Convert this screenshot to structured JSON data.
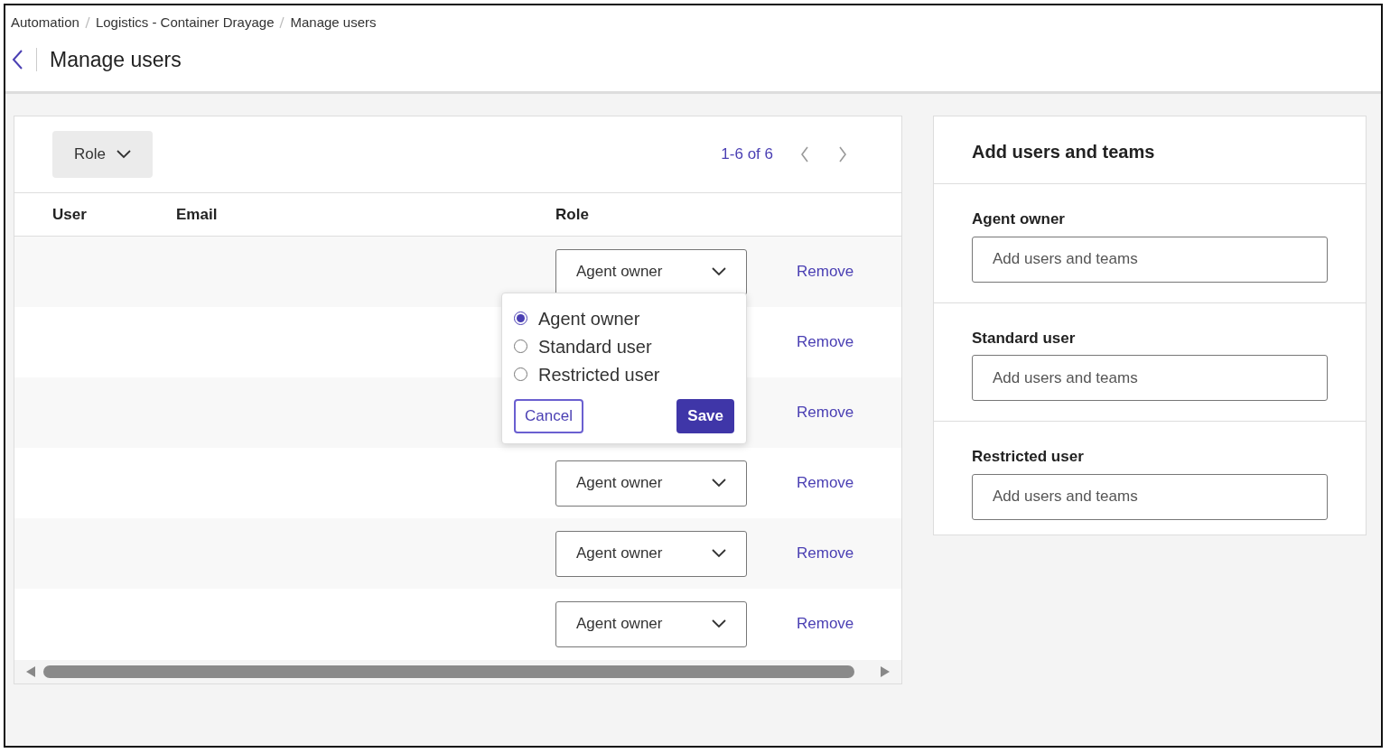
{
  "breadcrumbs": [
    "Automation",
    "Logistics - Container Drayage",
    "Manage users"
  ],
  "title": "Manage users",
  "filter": {
    "label": "Role"
  },
  "pagination": {
    "range": "1-6 of 6"
  },
  "table": {
    "columns": [
      "User",
      "Email",
      "Role"
    ],
    "rows": [
      {
        "role": "Agent owner",
        "action": "Remove"
      },
      {
        "action": "Remove"
      },
      {
        "action": "Remove"
      },
      {
        "role": "Agent owner",
        "action": "Remove"
      },
      {
        "role": "Agent owner",
        "action": "Remove"
      },
      {
        "role": "Agent owner",
        "action": "Remove"
      }
    ]
  },
  "role_popover": {
    "options": [
      {
        "label": "Agent owner",
        "selected": true
      },
      {
        "label": "Standard user",
        "selected": false
      },
      {
        "label": "Restricted user",
        "selected": false
      }
    ],
    "cancel": "Cancel",
    "save": "Save"
  },
  "side_panel": {
    "title": "Add users and teams",
    "sections": [
      {
        "label": "Agent owner",
        "placeholder": "Add users and teams"
      },
      {
        "label": "Standard user",
        "placeholder": "Add users and teams"
      },
      {
        "label": "Restricted user",
        "placeholder": "Add users and teams"
      }
    ]
  }
}
